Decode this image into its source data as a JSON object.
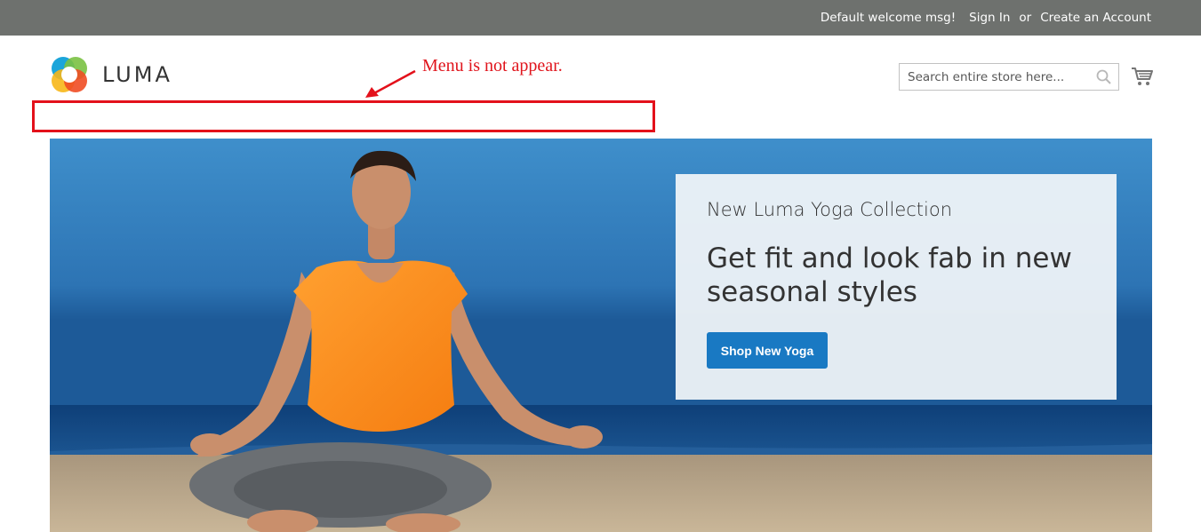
{
  "header": {
    "welcome": "Default welcome msg!",
    "sign_in": "Sign In",
    "or": "or",
    "create_account": "Create an Account"
  },
  "logo": {
    "text": "LUMA"
  },
  "search": {
    "placeholder": "Search entire store here..."
  },
  "annotation": {
    "text": "Menu is not appear.",
    "color": "#e3111b"
  },
  "hero": {
    "kicker": "New Luma Yoga Collection",
    "headline": "Get fit and look fab in new seasonal styles",
    "button": "Shop New Yoga"
  },
  "colors": {
    "topbar": "#6e716e",
    "button": "#1979c3",
    "shirt": "#ff8c1a"
  },
  "icons": {
    "search": "search-icon",
    "cart": "cart-icon",
    "logo": "luma-logo-icon"
  }
}
